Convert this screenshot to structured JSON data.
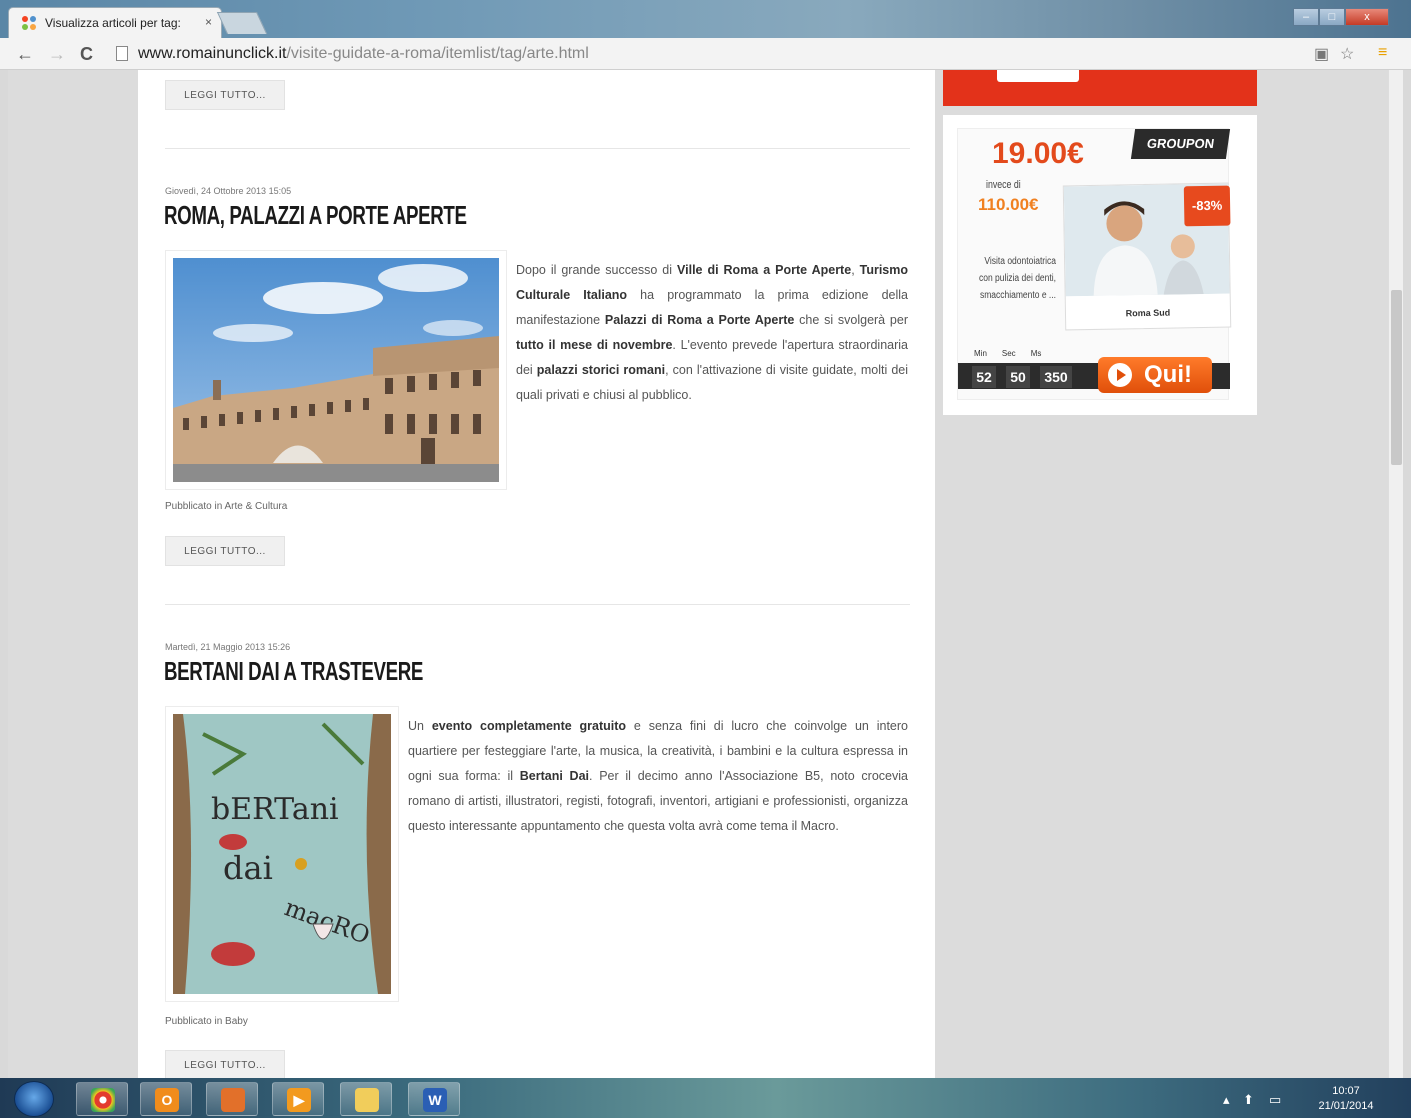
{
  "browser": {
    "tab_title": "Visualizza articoli per tag:",
    "tab_close": "×",
    "url_host": "www.romainunclick.it",
    "url_path": "/visite-guidate-a-roma/itemlist/tag/arte.html",
    "window_controls": [
      "–",
      "□",
      "x"
    ]
  },
  "page": {
    "readmore_label": "LEGGI TUTTO...",
    "articles": [
      {
        "date": "Giovedì, 24 Ottobre 2013 15:05",
        "title": "ROMA, PALAZZI A PORTE APERTE",
        "text_parts": [
          {
            "t": "Dopo il grande successo di ",
            "b": false
          },
          {
            "t": "Ville di Roma a Porte Aperte",
            "b": true
          },
          {
            "t": ", ",
            "b": false
          },
          {
            "t": "Turismo Culturale Italiano",
            "b": true
          },
          {
            "t": " ha programmato la prima edizione della manifestazione ",
            "b": false
          },
          {
            "t": "Palazzi di Roma a Porte Aperte",
            "b": true
          },
          {
            "t": " che si svolgerà per ",
            "b": false
          },
          {
            "t": "tutto il mese di novembre",
            "b": true
          },
          {
            "t": ". L'evento prevede l'apertura straordinaria dei ",
            "b": false
          },
          {
            "t": "palazzi storici romani",
            "b": true
          },
          {
            "t": ", con l'attivazione di visite guidate, molti dei quali privati e chiusi al pubblico.",
            "b": false
          }
        ],
        "published": "Pubblicato in Arte & Cultura"
      },
      {
        "date": "Martedì, 21 Maggio 2013 15:26",
        "title": "BERTANI DAI A TRASTEVERE",
        "text_parts": [
          {
            "t": "Un ",
            "b": false
          },
          {
            "t": "evento completamente gratuito",
            "b": true
          },
          {
            "t": " e senza fini di lucro che coinvolge un intero quartiere per festeggiare l'arte, la musica, la creatività, i bambini e la cultura espressa in ogni sua forma: il ",
            "b": false
          },
          {
            "t": "Bertani Dai",
            "b": true
          },
          {
            "t": ". Per il decimo anno l'Associazione B5, noto crocevia romano di artisti, illustratori, registi, fotografi, inventori, artigiani e professionisti, organizza questo interessante appuntamento che questa volta avrà come tema il Macro.",
            "b": false
          }
        ],
        "published": "Pubblicato in Baby"
      }
    ],
    "poster_text": [
      "bERTani",
      "dai",
      "macRO"
    ]
  },
  "sidebar": {
    "ad": {
      "price": "19.00€",
      "brand": "GROUPON",
      "instead_label": "invece di",
      "old_price": "110.00€",
      "discount": "-83%",
      "description": "Visita odontoiatrica con pulizia dei denti, smacchiamento e ...",
      "photo_caption": "Roma Sud",
      "countdown_labels": [
        "Min",
        "Sec",
        "Ms"
      ],
      "countdown_values": [
        "52",
        "50",
        "350"
      ],
      "cta": "Qui!"
    }
  },
  "taskbar": {
    "time": "10:07",
    "date": "21/01/2014"
  },
  "colors": {
    "accent_red": "#e3321a",
    "price_orange": "#e34a1c",
    "old_price_orange": "#f08020"
  }
}
